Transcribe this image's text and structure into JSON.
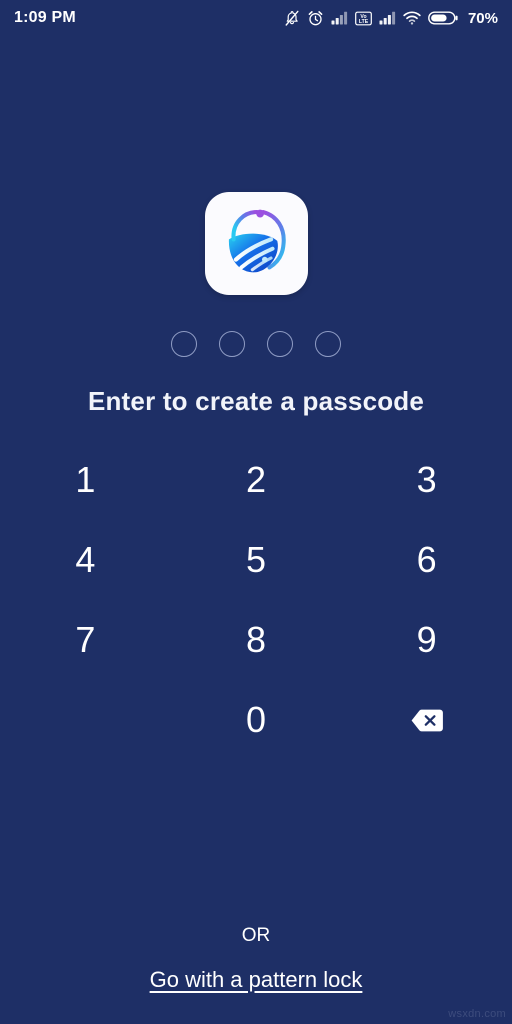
{
  "theme": {
    "background": "#1e2f66",
    "text": "#ffffff",
    "dot_outline": "#8f9cc4",
    "watermark_color": "#3d4c7d"
  },
  "status_bar": {
    "time": "1:09 PM",
    "battery_percent": "70%",
    "icons": [
      "notifications-off-icon",
      "alarm-icon",
      "signal-bars-sim1-icon",
      "volte-icon",
      "signal-bars-sim2-icon",
      "wifi-icon",
      "battery-icon"
    ]
  },
  "app": {
    "logo_name": "app-logo-shield-icon",
    "logo_colors": {
      "purple": "#9b4fe0",
      "violet": "#7b5be0",
      "cyan": "#26d0f0",
      "blue": "#1565e8",
      "deep_blue": "#0f46c8",
      "tile_background": "#fbfbfe"
    }
  },
  "passcode": {
    "title": "Enter to create a passcode",
    "length": 4,
    "entered": 0,
    "dots": [
      {
        "filled": false
      },
      {
        "filled": false
      },
      {
        "filled": false
      },
      {
        "filled": false
      }
    ]
  },
  "keypad": {
    "keys": [
      {
        "label": "1",
        "name": "key-1",
        "type": "digit"
      },
      {
        "label": "2",
        "name": "key-2",
        "type": "digit"
      },
      {
        "label": "3",
        "name": "key-3",
        "type": "digit"
      },
      {
        "label": "4",
        "name": "key-4",
        "type": "digit"
      },
      {
        "label": "5",
        "name": "key-5",
        "type": "digit"
      },
      {
        "label": "6",
        "name": "key-6",
        "type": "digit"
      },
      {
        "label": "7",
        "name": "key-7",
        "type": "digit"
      },
      {
        "label": "8",
        "name": "key-8",
        "type": "digit"
      },
      {
        "label": "9",
        "name": "key-9",
        "type": "digit"
      },
      {
        "label": "",
        "name": "key-blank",
        "type": "blank"
      },
      {
        "label": "0",
        "name": "key-0",
        "type": "digit"
      },
      {
        "label": "",
        "name": "key-backspace",
        "type": "backspace"
      }
    ]
  },
  "alternatives": {
    "or_label": "OR",
    "pattern_link_label": "Go with a pattern lock"
  },
  "watermark": {
    "text": "wsxdn.com"
  }
}
